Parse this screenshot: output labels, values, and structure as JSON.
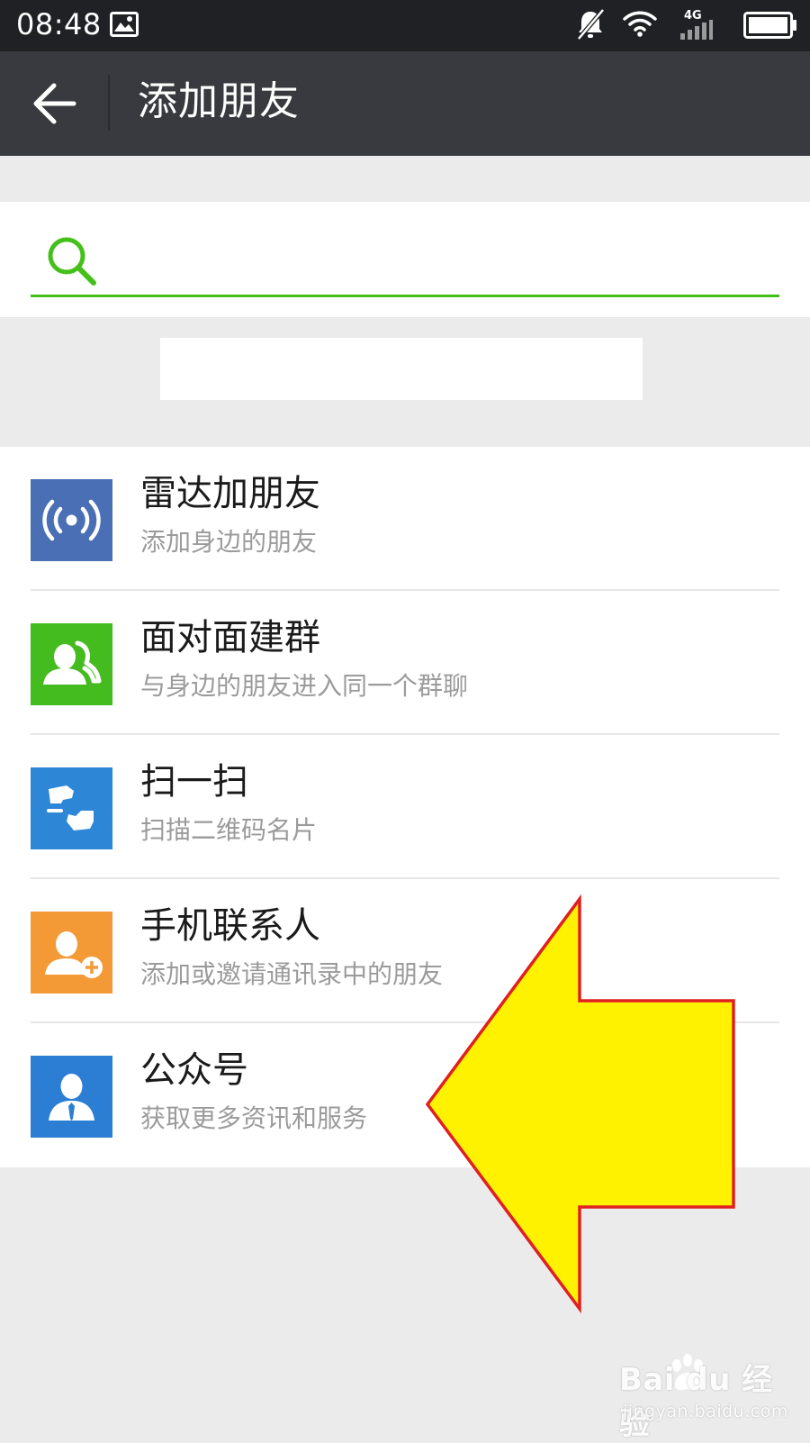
{
  "status_bar": {
    "time": "08:48",
    "network_label": "4G",
    "icons": [
      "image-notification-icon",
      "mute-icon",
      "wifi-icon",
      "signal-icon",
      "battery-icon"
    ]
  },
  "header": {
    "title": "添加朋友",
    "back_icon": "back-arrow-icon"
  },
  "search": {
    "icon": "search-icon",
    "value": "",
    "placeholder": ""
  },
  "menu": {
    "items": [
      {
        "title": "雷达加朋友",
        "subtitle": "添加身边的朋友",
        "icon": "radar-icon",
        "color": "#4a6fb5"
      },
      {
        "title": "面对面建群",
        "subtitle": "与身边的朋友进入同一个群聊",
        "icon": "group-chat-icon",
        "color": "#44bb1f"
      },
      {
        "title": "扫一扫",
        "subtitle": "扫描二维码名片",
        "icon": "scan-icon",
        "color": "#2d86d6"
      },
      {
        "title": "手机联系人",
        "subtitle": "添加或邀请通讯录中的朋友",
        "icon": "phone-contact-add-icon",
        "color": "#f39a37"
      },
      {
        "title": "公众号",
        "subtitle": "获取更多资讯和服务",
        "icon": "official-account-icon",
        "color": "#2b7ed3"
      }
    ]
  },
  "overlay": {
    "arrow_fill": "#fff200",
    "arrow_stroke": "#e02020",
    "arrow_direction": "left"
  },
  "watermark": {
    "main": "Bai du 经验",
    "sub": "jingyan.baidu.com"
  },
  "colors": {
    "status_bar": "#202124",
    "title_bar": "#393a3f",
    "accent": "#45c01a",
    "background": "#ebebeb"
  }
}
